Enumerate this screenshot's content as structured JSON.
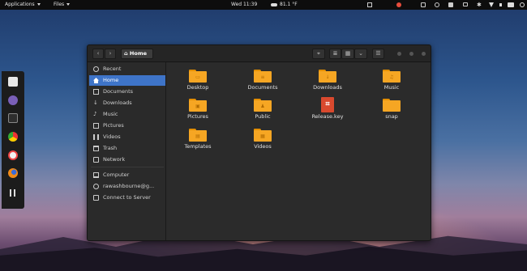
{
  "topbar": {
    "applications_label": "Applications",
    "files_label": "Files",
    "clock": "Wed 11:39",
    "weather": "81.1 °F"
  },
  "dock": {
    "items": [
      "software-center-icon",
      "settings-icon",
      "terminal-icon",
      "chrome-icon",
      "help-icon",
      "firefox-icon",
      "app-grid-icon"
    ]
  },
  "window": {
    "path_label": "Home",
    "sidebar": {
      "items": [
        {
          "label": "Recent",
          "icon": "clock-icon"
        },
        {
          "label": "Home",
          "icon": "home-icon",
          "active": true
        },
        {
          "label": "Documents",
          "icon": "documents-icon"
        },
        {
          "label": "Downloads",
          "icon": "downloads-icon"
        },
        {
          "label": "Music",
          "icon": "music-icon"
        },
        {
          "label": "Pictures",
          "icon": "pictures-icon"
        },
        {
          "label": "Videos",
          "icon": "videos-icon"
        },
        {
          "label": "Trash",
          "icon": "trash-icon"
        },
        {
          "label": "Network",
          "icon": "network-icon"
        },
        {
          "label": "Computer",
          "icon": "computer-icon"
        },
        {
          "label": "rawashbourne@g...",
          "icon": "account-icon"
        },
        {
          "label": "Connect to Server",
          "icon": "server-icon"
        }
      ]
    },
    "files": [
      {
        "name": "Desktop",
        "glyph": "▭"
      },
      {
        "name": "Documents",
        "glyph": "≡"
      },
      {
        "name": "Downloads",
        "glyph": "↓"
      },
      {
        "name": "Music",
        "glyph": "♫"
      },
      {
        "name": "Pictures",
        "glyph": "▣"
      },
      {
        "name": "Public",
        "glyph": "♟"
      },
      {
        "name": "Release.key",
        "glyph": "⌗"
      },
      {
        "name": "snap",
        "glyph": ""
      },
      {
        "name": "Templates",
        "glyph": "▤"
      },
      {
        "name": "Videos",
        "glyph": "▦"
      }
    ]
  },
  "colors": {
    "accent": "#3e74c8",
    "folder": "#f6a623",
    "folder_tab": "#e58f00",
    "document": "#d9492e"
  }
}
